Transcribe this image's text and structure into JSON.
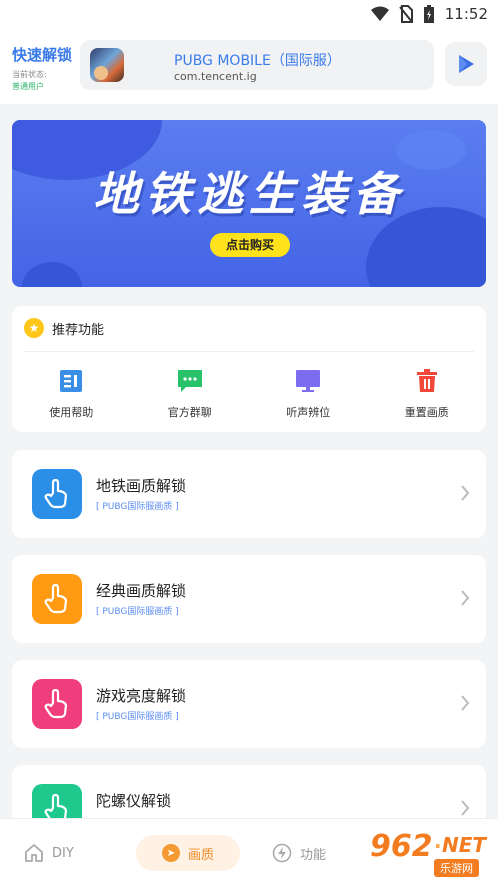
{
  "status_bar": {
    "time": "11:52",
    "icons": [
      "wifi-icon",
      "no-sim-icon",
      "battery-charging-icon"
    ]
  },
  "header": {
    "brand_title": "快速解锁",
    "brand_status_label": "当前状态:",
    "brand_status_value": "普通用户",
    "app": {
      "name": "PUBG MOBILE（国际服）",
      "package": "com.tencent.ig"
    },
    "play_icon": "play-icon"
  },
  "banner": {
    "title": "地铁逃生装备",
    "button": "点击购买"
  },
  "recommend": {
    "title": "推荐功能",
    "items": [
      {
        "label": "使用帮助",
        "icon": "help-doc-icon",
        "color": "#3a8ee6"
      },
      {
        "label": "官方群聊",
        "icon": "chat-icon",
        "color": "#27c26a"
      },
      {
        "label": "听声辨位",
        "icon": "monitor-icon",
        "color": "#7b6cf0"
      },
      {
        "label": "重置画质",
        "icon": "trash-icon",
        "color": "#f0473a"
      }
    ]
  },
  "features": [
    {
      "title": "地铁画质解锁",
      "subtitle": "[ PUBG国际服画质 ]",
      "color": "#2b8fe8",
      "icon": "tap-hand-icon"
    },
    {
      "title": "经典画质解锁",
      "subtitle": "[ PUBG国际服画质 ]",
      "color": "#ff9a12",
      "icon": "tap-hand-icon"
    },
    {
      "title": "游戏亮度解锁",
      "subtitle": "[ PUBG国际服画质 ]",
      "color": "#f03e7c",
      "icon": "tap-hand-icon"
    },
    {
      "title": "陀螺仪解锁",
      "subtitle": "",
      "color": "#1fc98e",
      "icon": "tap-hand-icon"
    }
  ],
  "bottom_nav": [
    {
      "label": "DIY",
      "icon": "home-icon",
      "active": false
    },
    {
      "label": "画质",
      "icon": "compass-icon",
      "active": true
    },
    {
      "label": "功能",
      "icon": "lightning-icon",
      "active": false
    }
  ],
  "watermark": {
    "number": "962",
    "dot": ".",
    "net": "NET",
    "sub": "乐游网"
  }
}
